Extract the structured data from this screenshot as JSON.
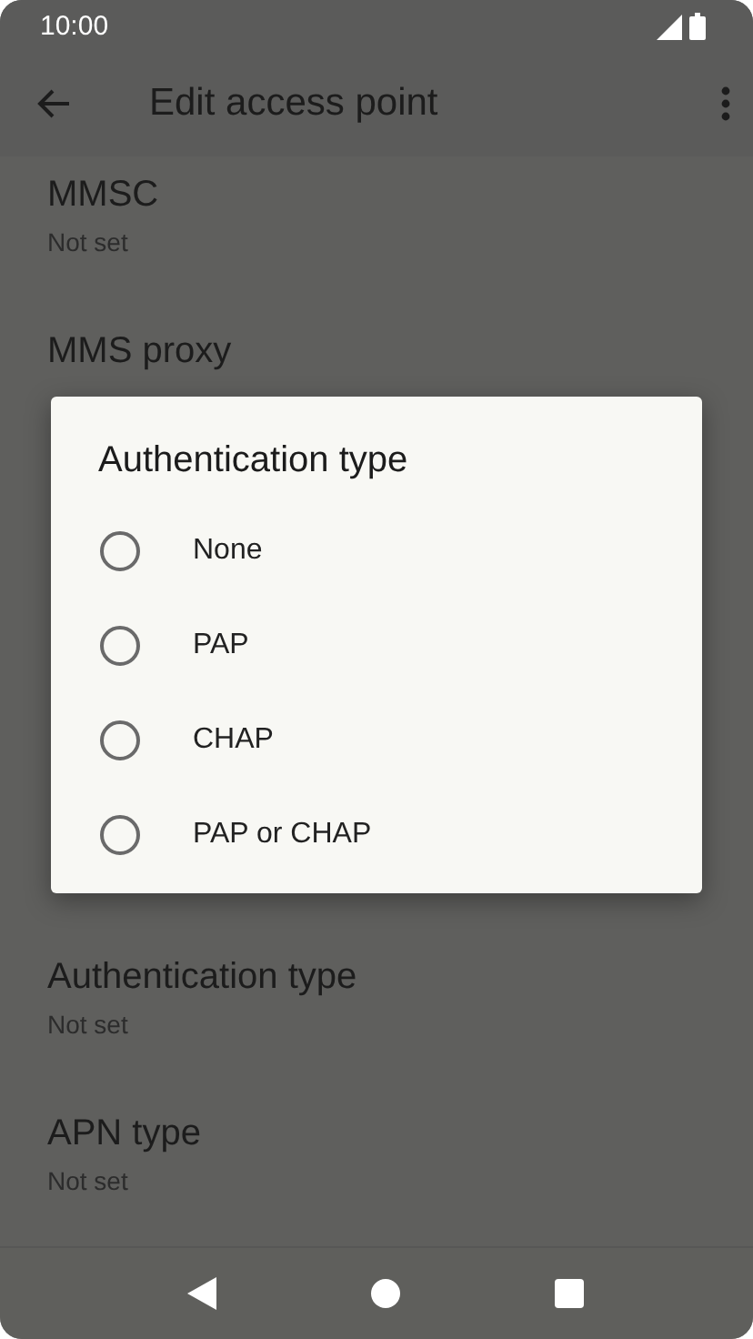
{
  "status_bar": {
    "time": "10:00"
  },
  "toolbar": {
    "title": "Edit access point"
  },
  "settings_above": [
    {
      "title": "MMSC",
      "value": "Not set"
    },
    {
      "title": "MMS proxy"
    }
  ],
  "settings_below": [
    {
      "title": "Authentication type",
      "value": "Not set"
    },
    {
      "title": "APN type",
      "value": "Not set"
    }
  ],
  "dialog": {
    "title": "Authentication type",
    "options": [
      {
        "label": "None",
        "selected": false
      },
      {
        "label": "PAP",
        "selected": false
      },
      {
        "label": "CHAP",
        "selected": false
      },
      {
        "label": "PAP or CHAP",
        "selected": false
      }
    ]
  }
}
